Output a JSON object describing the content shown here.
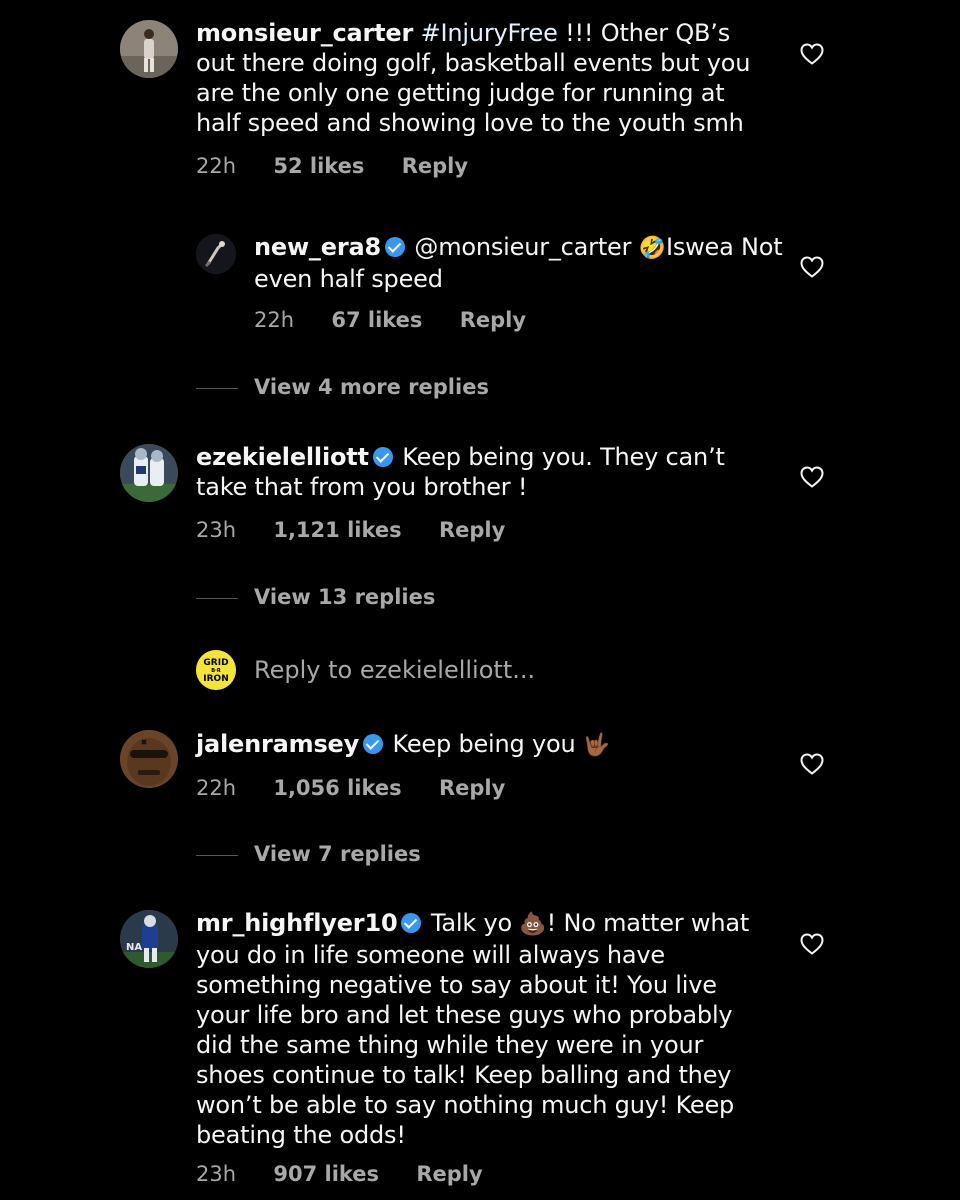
{
  "comments": [
    {
      "username": "monsieur_carter",
      "hashtag": "#InjuryFree",
      "body": " !!! Other QB’s out there doing golf, basketball events but you are the only one getting judge for running at half speed and showing love to the youth smh",
      "time": "22h",
      "likes": "52 likes",
      "reply": "Reply"
    },
    {
      "username": "new_era8",
      "mention": "@monsieur_carter",
      "emoji": "🤣",
      "body": "Iswea Not even half speed",
      "time": "22h",
      "likes": "67 likes",
      "reply": "Reply"
    },
    {
      "username": "ezekielelliott",
      "body": "Keep being you. They can’t take that from you brother !",
      "time": "23h",
      "likes": "1,121 likes",
      "reply": "Reply"
    },
    {
      "username": "jalenramsey",
      "body": "Keep being you",
      "emoji": "🤟🏾",
      "time": "22h",
      "likes": "1,056 likes",
      "reply": "Reply"
    },
    {
      "username": "mr_highflyer10",
      "body_pre": "Talk yo",
      "emoji": "💩",
      "body": "! No matter what you do in life someone will always have something negative to say about it! You live your life bro and let these guys who probably did the same thing while they were in your shoes continue to talk! Keep balling and they won’t be able to say nothing much guy! Keep beating the odds!",
      "time": "23h",
      "likes": "907 likes",
      "reply": "Reply"
    }
  ],
  "view_replies": {
    "monsieur_carter": "View 4 more replies",
    "ezekielelliott": "View 13 replies",
    "jalenramsey": "View 7 replies"
  },
  "reply_input": {
    "avatar_text": "GRID B·R IRON",
    "placeholder": "Reply to ezekielelliott..."
  },
  "colors": {
    "background": "#000000",
    "text": "#f5f5f5",
    "muted": "#a8a8a8",
    "verified": "#3897f0",
    "gridiron_yellow": "#f2e43a"
  },
  "icons": {
    "like": "heart-outline-icon",
    "verified": "verified-badge-icon"
  }
}
